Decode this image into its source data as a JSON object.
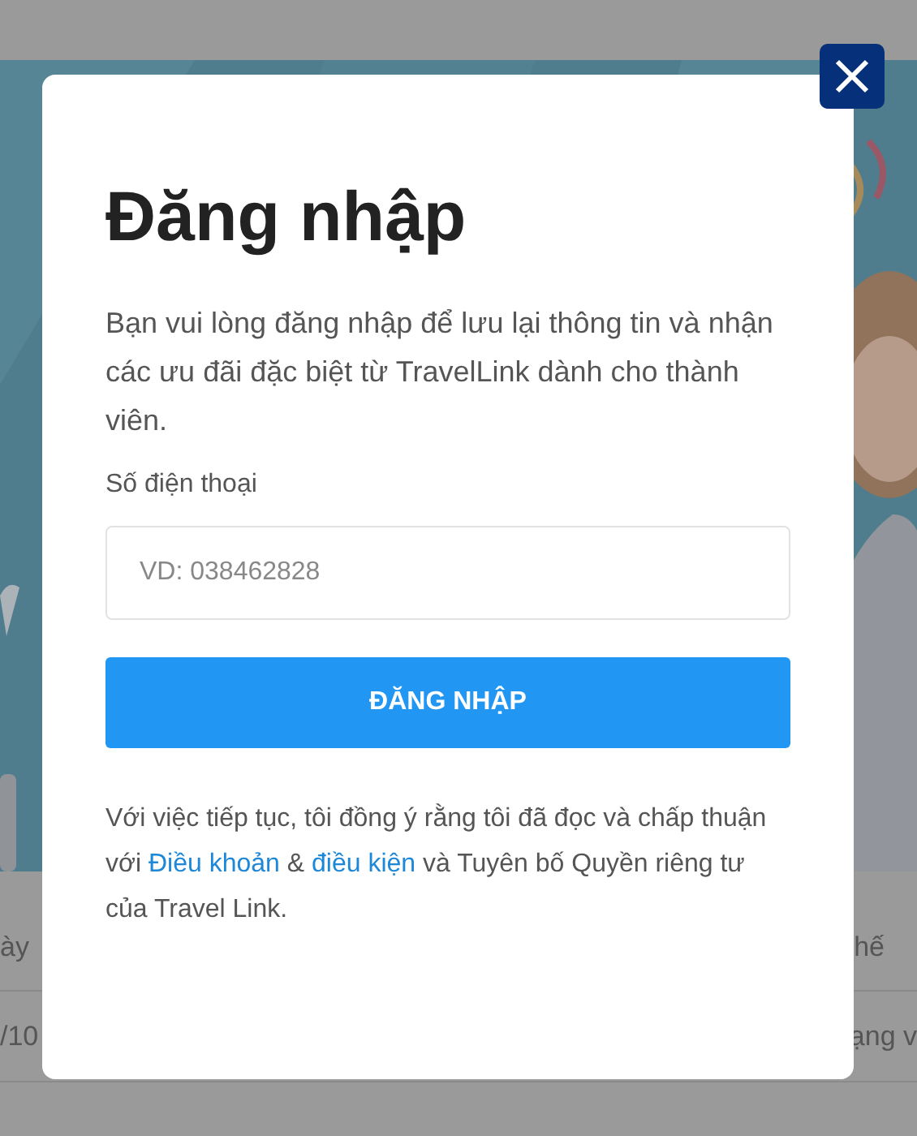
{
  "backdrop": {
    "table": {
      "header": [
        "ày",
        "hế"
      ],
      "rows": [
        [
          "/10",
          "ạng v"
        ]
      ]
    }
  },
  "dialog": {
    "title": "Đăng nhập",
    "description": "Bạn vui lòng đăng nhập để lưu lại thông tin và nhận các ưu đãi đặc biệt từ TravelLink dành cho thành viên.",
    "phone_field": {
      "label": "Số điện thoại",
      "placeholder": "VD: 038462828"
    },
    "submit_button": "ĐĂNG NHẬP",
    "terms": [
      {
        "kind": "text",
        "text": "Với việc tiếp tục, tôi đồng ý rằng tôi đã đọc và chấp thuận với "
      },
      {
        "kind": "link",
        "text": "Điều khoản"
      },
      {
        "kind": "text",
        "text": " & "
      },
      {
        "kind": "link",
        "text": "điều kiện"
      },
      {
        "kind": "text",
        "text": " và Tuyên bố Quyền riêng tư của Travel Link."
      }
    ]
  }
}
